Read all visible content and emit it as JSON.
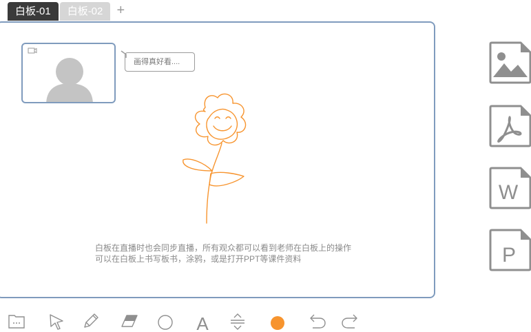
{
  "tabs": [
    {
      "label": "白板-01",
      "active": true
    },
    {
      "label": "白板-02",
      "active": false
    }
  ],
  "add_tab_label": "+",
  "board": {
    "chat_bubble": "画得真好看....",
    "caption_line1": "白板在直播时也会同步直播，所有观众都可以看到老师在白板上的操作",
    "caption_line2": "可以在白板上书写板书，涂鸦，或是打开PPT等课件资料"
  },
  "side_files": {
    "word_letter": "W",
    "ppt_letter": "P",
    "icons": [
      "image-file-icon",
      "pdf-file-icon",
      "word-file-icon",
      "ppt-file-icon"
    ]
  },
  "toolbar": {
    "text_tool_label": "A",
    "current_color": "#f7942e",
    "tools": [
      "folder",
      "select",
      "pencil",
      "eraser",
      "circle",
      "text",
      "line-spacing",
      "color",
      "undo",
      "redo"
    ]
  },
  "colors": {
    "accent_border": "#7f9bbd",
    "drawing": "#f7942e",
    "icon_gray": "#8f8f8f"
  }
}
